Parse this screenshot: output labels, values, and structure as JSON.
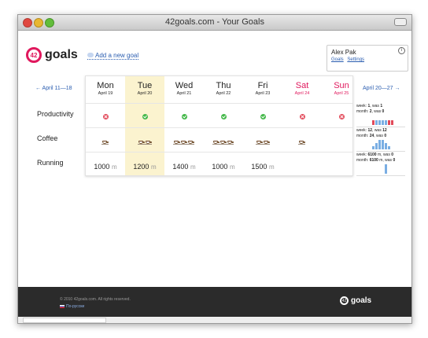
{
  "window": {
    "title": "42goals.com - Your Goals"
  },
  "header": {
    "logo_badge": "42",
    "logo_text": "goals",
    "add_goal_label": "Add a new goal",
    "user": {
      "name": "Alex Pak",
      "links": [
        "Goals",
        "Settings"
      ],
      "info_icon": "i"
    }
  },
  "nav": {
    "prev": "← April 11—18",
    "next": "April 20—27 →"
  },
  "days": [
    {
      "name": "Mon",
      "date": "April 19",
      "weekend": false
    },
    {
      "name": "Tue",
      "date": "April 20",
      "weekend": false,
      "today": true
    },
    {
      "name": "Wed",
      "date": "April 21",
      "weekend": false
    },
    {
      "name": "Thu",
      "date": "April 22",
      "weekend": false
    },
    {
      "name": "Fri",
      "date": "April 23",
      "weekend": false
    },
    {
      "name": "Sat",
      "date": "April 24",
      "weekend": true
    },
    {
      "name": "Sun",
      "date": "April 25",
      "weekend": true
    }
  ],
  "goals": [
    {
      "label": "Productivity",
      "type": "boolean",
      "values": [
        "no",
        "yes",
        "yes",
        "yes",
        "yes",
        "no",
        "no"
      ],
      "stats": {
        "week_value": "1",
        "week_was": "1",
        "month_value": "2",
        "month_was": "0"
      },
      "spark": [
        0,
        1,
        1,
        1,
        1,
        0,
        0
      ]
    },
    {
      "label": "Coffee",
      "type": "count",
      "values": [
        1,
        2,
        3,
        3,
        2,
        1,
        0
      ],
      "stats": {
        "week_value": "12",
        "week_was": "12",
        "month_value": "24",
        "month_was": "0"
      },
      "spark": [
        1,
        2,
        3,
        3,
        2,
        1,
        0
      ]
    },
    {
      "label": "Running",
      "type": "number",
      "unit": "m",
      "values": [
        "1000",
        "1200",
        "1400",
        "1000",
        "1500",
        "",
        ""
      ],
      "stats": {
        "week_value": "6100",
        "week_unit": "m",
        "week_was": "0",
        "month_value": "6100",
        "month_unit": "m",
        "month_was": "0"
      },
      "spark": [
        0,
        0,
        0,
        0,
        1,
        0,
        0
      ]
    }
  ],
  "stat_labels": {
    "week": "week",
    "month": "month",
    "was": "was"
  },
  "footer": {
    "copyright": "© 2010 42goals.com. All rights reserved.",
    "language": "По-русски",
    "logo_badge": "42",
    "logo_text": "goals"
  },
  "colors": {
    "accent": "#e0185d",
    "link": "#2a5db0",
    "today_bg": "#fbf3cf",
    "spark_blue": "#7aaee3",
    "spark_red": "#e24a5a"
  }
}
